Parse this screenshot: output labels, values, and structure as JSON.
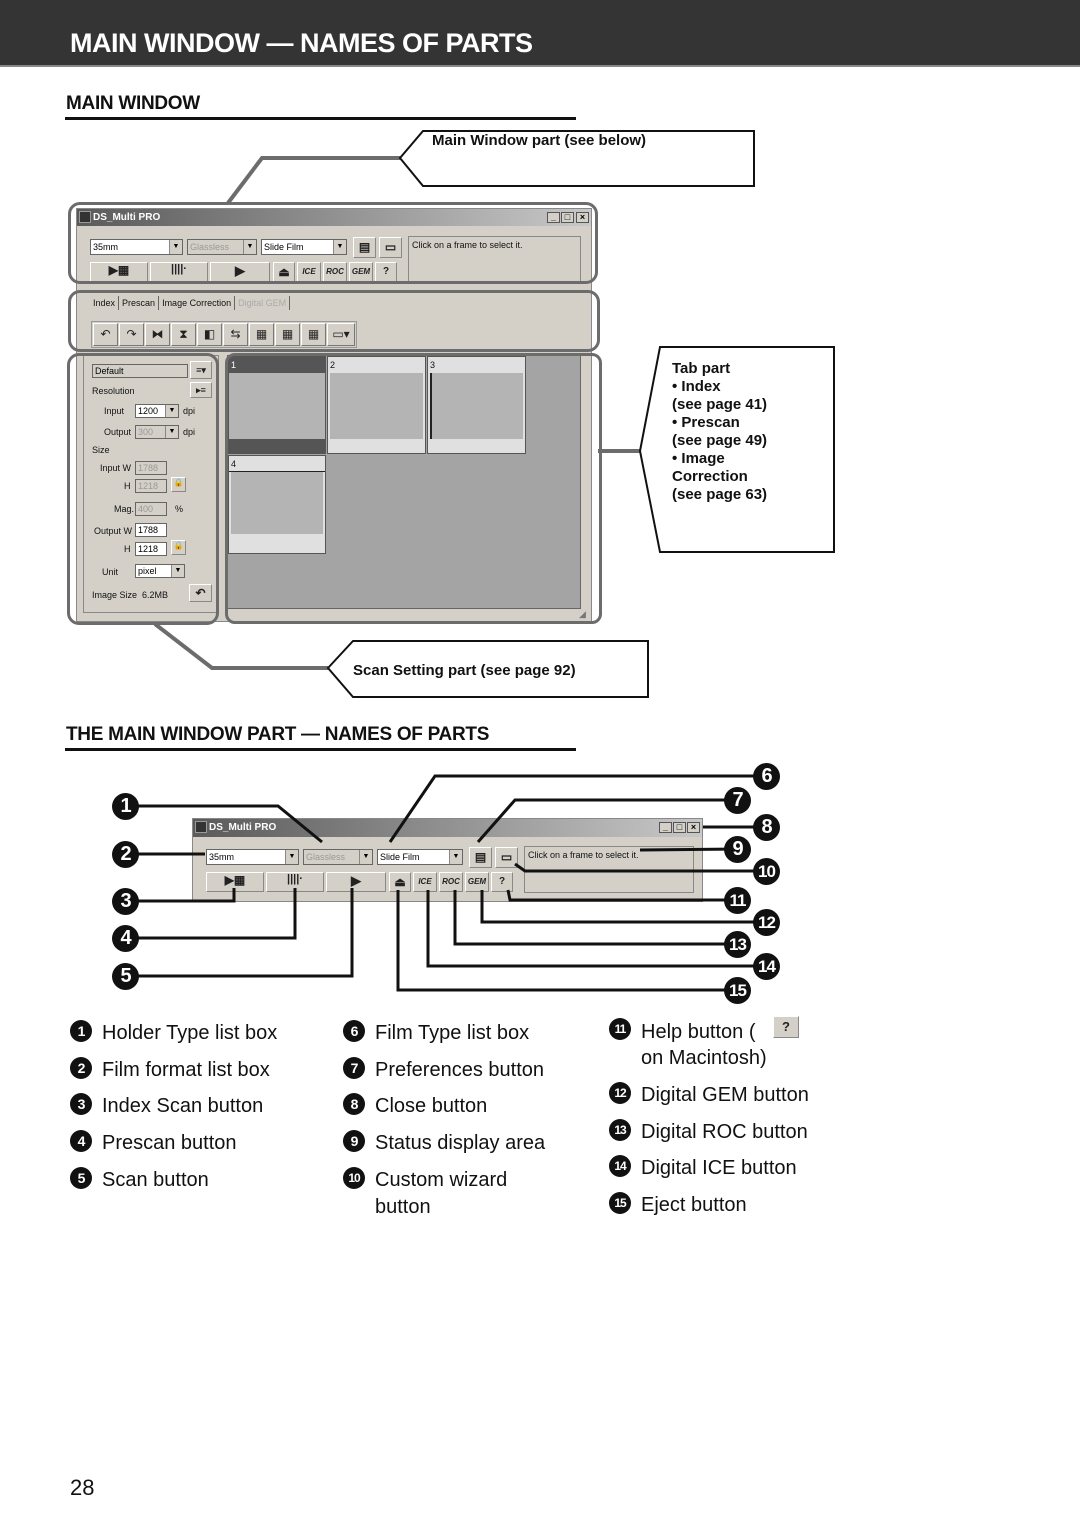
{
  "header": {
    "title": "MAIN WINDOW — NAMES OF PARTS"
  },
  "section1": {
    "heading": "MAIN WINDOW"
  },
  "section2": {
    "heading": "THE MAIN WINDOW PART — NAMES OF PARTS"
  },
  "callouts": {
    "main_window_part": "Main Window part (see below)",
    "tab_part": {
      "title": "Tab part",
      "lines": [
        "• Index",
        "(see page 41)",
        "• Prescan",
        "(see page 49)",
        "• Image",
        "Correction",
        "(see page 63)"
      ]
    },
    "scan_setting_part": "Scan Setting part (see page 92)"
  },
  "app": {
    "window_title": "DS_Multi PRO",
    "title_buttons": {
      "minimize": "_",
      "maximize": "□",
      "close": "×"
    },
    "holder_type": "35mm",
    "film_format": "Glassless",
    "film_type": "Slide Film",
    "status_text": "Click on a frame to select it.",
    "toolbar_buttons": {
      "eject": "⏏",
      "ice": "ICE",
      "roc": "ROC",
      "gem": "GEM",
      "help": "?"
    },
    "tabs": [
      {
        "label": "Index",
        "enabled": true
      },
      {
        "label": "Prescan",
        "enabled": true
      },
      {
        "label": "Image Correction",
        "enabled": true
      },
      {
        "label": "Digital GEM",
        "enabled": false
      }
    ],
    "tools": [
      "rotate-left",
      "rotate-right",
      "flip-horizontal",
      "flip-vertical",
      "negative-positive",
      "crop-swap",
      "select-all",
      "select-invert",
      "deselect",
      "view-options"
    ],
    "scan_settings": {
      "preset": "Default",
      "resolution_label": "Resolution",
      "input_label": "Input",
      "input_value": "1200",
      "input_unit": "dpi",
      "output_label": "Output",
      "output_value": "300",
      "output_unit": "dpi",
      "size_label": "Size",
      "input_w_label": "Input W",
      "input_w_value": "1788",
      "input_h_label": "H",
      "input_h_value": "1218",
      "mag_label": "Mag.",
      "mag_value": "400",
      "mag_unit": "%",
      "output_w_label": "Output W",
      "output_w_value": "1788",
      "output_h_label": "H",
      "output_h_value": "1218",
      "unit_label": "Unit",
      "unit_value": "pixel",
      "image_size_label": "Image Size",
      "image_size_value": "6.2MB"
    },
    "frames": [
      {
        "number": "1",
        "selected": true
      },
      {
        "number": "2",
        "selected": false
      },
      {
        "number": "3",
        "selected": false
      },
      {
        "number": "4",
        "selected": false
      }
    ]
  },
  "legend": [
    {
      "number": "1",
      "label": "Holder Type list box"
    },
    {
      "number": "2",
      "label": "Film format list box"
    },
    {
      "number": "3",
      "label": "Index Scan button"
    },
    {
      "number": "4",
      "label": "Prescan button"
    },
    {
      "number": "5",
      "label": "Scan button"
    },
    {
      "number": "6",
      "label": "Film Type list box"
    },
    {
      "number": "7",
      "label": "Preferences button"
    },
    {
      "number": "8",
      "label": "Close button"
    },
    {
      "number": "9",
      "label": "Status display area"
    },
    {
      "number": "10",
      "label": "Custom wizard",
      "label2": "button"
    },
    {
      "number": "11",
      "label": "Help button (",
      "label2": "on Macintosh)"
    },
    {
      "number": "12",
      "label": "Digital GEM button"
    },
    {
      "number": "13",
      "label": "Digital ROC button"
    },
    {
      "number": "14",
      "label": "Digital ICE button"
    },
    {
      "number": "15",
      "label": "Eject button"
    }
  ],
  "page_number": "28"
}
